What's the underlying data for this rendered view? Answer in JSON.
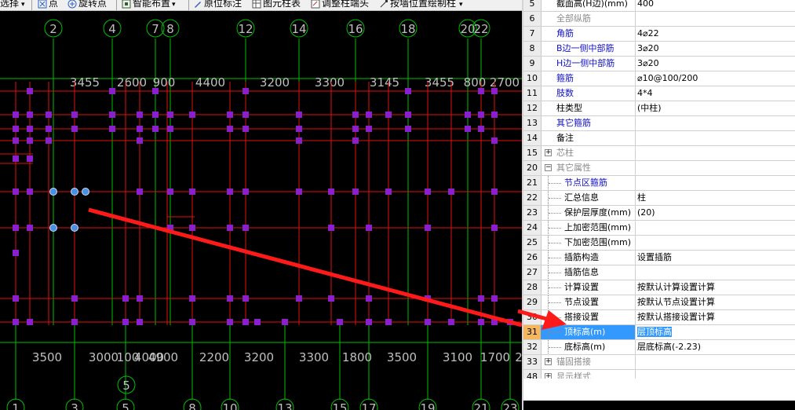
{
  "toolbar": {
    "select": "选择",
    "point": "点",
    "rotate_point": "旋转点",
    "smart_layout": "智能布置",
    "in_situ_label": "原位标注",
    "column_table": "图元柱表",
    "adjust_column_end": "调整柱端头",
    "draw_by_wall": "按墙位置绘制柱"
  },
  "canvas": {
    "colors": {
      "grid": "#00c000",
      "beam": "#e01010",
      "column": "#8a1fd0",
      "dim": "#bfbfbf",
      "bubble": "#00c000",
      "arrow": "#ff1a1a",
      "selected": "#4a90e2"
    },
    "top_axes": [
      "2",
      "4",
      "7",
      "8",
      "12",
      "14",
      "16",
      "18",
      "20",
      "22"
    ],
    "bottom_axes": [
      "1",
      "3",
      "5",
      "8",
      "10",
      "13",
      "15",
      "17",
      "19",
      "21",
      "23"
    ],
    "left_axis": "5",
    "top_dims": [
      "3455",
      "2600",
      "900",
      "4400",
      "3200",
      "3300",
      "3145",
      "3455",
      "800",
      "2700"
    ],
    "bottom_dims": [
      "3500",
      "3000",
      "100",
      "4000",
      "4900",
      "2200",
      "3200",
      "3300",
      "1800",
      "3500",
      "3100",
      "1700",
      "2"
    ]
  },
  "props": {
    "rows": [
      {
        "num": "5",
        "name": "截面高(H边)(mm)",
        "value": "400",
        "style": "black"
      },
      {
        "num": "6",
        "name": "全部纵筋",
        "value": "",
        "style": "gray"
      },
      {
        "num": "7",
        "name": "角筋",
        "value": "4⌀22",
        "style": "blue"
      },
      {
        "num": "8",
        "name": "B边一侧中部筋",
        "value": "3⌀20",
        "style": "blue"
      },
      {
        "num": "9",
        "name": "H边一侧中部筋",
        "value": "3⌀20",
        "style": "blue"
      },
      {
        "num": "10",
        "name": "箍筋",
        "value": "⌀10@100/200",
        "style": "blue"
      },
      {
        "num": "11",
        "name": "肢数",
        "value": "4*4",
        "style": "blue"
      },
      {
        "num": "12",
        "name": "柱类型",
        "value": "(中柱)",
        "style": "black"
      },
      {
        "num": "13",
        "name": "其它箍筋",
        "value": "",
        "style": "blue"
      },
      {
        "num": "14",
        "name": "备注",
        "value": "",
        "style": "black"
      },
      {
        "num": "15",
        "name": "芯柱",
        "value": "",
        "style": "gray",
        "expander": "+"
      },
      {
        "num": "20",
        "name": "其它属性",
        "value": "",
        "style": "gray",
        "expander": "−"
      },
      {
        "num": "21",
        "name": "节点区箍筋",
        "value": "",
        "style": "blue",
        "child": true
      },
      {
        "num": "22",
        "name": "汇总信息",
        "value": "柱",
        "style": "black",
        "child": true
      },
      {
        "num": "23",
        "name": "保护层厚度(mm)",
        "value": "(20)",
        "style": "black",
        "child": true
      },
      {
        "num": "24",
        "name": "上加密范围(mm)",
        "value": "",
        "style": "black",
        "child": true
      },
      {
        "num": "25",
        "name": "下加密范围(mm)",
        "value": "",
        "style": "black",
        "child": true
      },
      {
        "num": "26",
        "name": "插筋构造",
        "value": "设置插筋",
        "style": "black",
        "child": true
      },
      {
        "num": "27",
        "name": "插筋信息",
        "value": "",
        "style": "black",
        "child": true
      },
      {
        "num": "28",
        "name": "计算设置",
        "value": "按默认计算设置计算",
        "style": "black",
        "child": true
      },
      {
        "num": "29",
        "name": "节点设置",
        "value": "按默认节点设置计算",
        "style": "black",
        "child": true
      },
      {
        "num": "30",
        "name": "搭接设置",
        "value": "按默认搭接设置计算",
        "style": "black",
        "child": true
      },
      {
        "num": "31",
        "name": "顶标高(m)",
        "value": "层顶标高",
        "style": "black",
        "child": true,
        "selected": true
      },
      {
        "num": "32",
        "name": "底标高(m)",
        "value": "层底标高(-2.23)",
        "style": "black",
        "child": true
      },
      {
        "num": "33",
        "name": "锚固搭接",
        "value": "",
        "style": "gray",
        "expander": "+"
      },
      {
        "num": "48",
        "name": "显示样式",
        "value": "",
        "style": "gray",
        "expander": "+"
      }
    ]
  }
}
